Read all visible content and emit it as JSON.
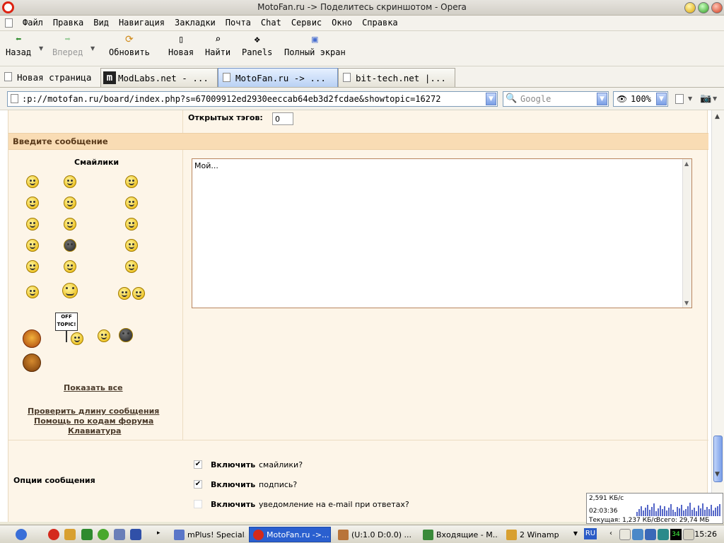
{
  "window": {
    "title": "MotoFan.ru -> Поделитесь скриншотом - Opera"
  },
  "menu": [
    "Файл",
    "Правка",
    "Вид",
    "Навигация",
    "Закладки",
    "Почта",
    "Chat",
    "Сервис",
    "Окно",
    "Справка"
  ],
  "toolbar": {
    "back": "Назад",
    "forward": "Вперед",
    "reload": "Обновить",
    "new": "Новая",
    "find": "Найти",
    "panels": "Panels",
    "fullscreen": "Полный экран"
  },
  "tabs": [
    {
      "label": "Новая страница"
    },
    {
      "label": "ModLabs.net - ..."
    },
    {
      "label": "MotoFan.ru -> ..."
    },
    {
      "label": "bit-tech.net |..."
    }
  ],
  "address": {
    "url": ":p://motofan.ru/board/index.php?s=67009912ed2930eeccab64eb3d2fcdae&showtopic=16272",
    "search_placeholder": "Google",
    "zoom": "100%"
  },
  "form": {
    "open_tags_label": "Открытых тэгов:",
    "open_tags_value": "0",
    "section_title": "Введите сообщение",
    "smilies_title": "Смайлики",
    "offtopic_line1": "OFF",
    "offtopic_line2": "TOPIC!",
    "show_all": "Показать все",
    "check_length": "Проверить длину сообщения",
    "bbcode_help": "Помощь по кодам форума",
    "keyboard": "Клавиатура",
    "message_text": "Мой...",
    "options_title": "Опции сообщения",
    "options": [
      {
        "bold": "Включить",
        "rest": "смайлики?",
        "checked": true
      },
      {
        "bold": "Включить",
        "rest": "подпись?",
        "checked": true
      },
      {
        "bold": "Включить",
        "rest": "уведомление на e-mail при ответах?",
        "checked": false
      }
    ]
  },
  "netmeter": {
    "speed": "2,591 КБ/с",
    "time": "02:03:36",
    "current": "Текущая: 1,237 КБ/с",
    "total": "Всего: 29,74 МБ"
  },
  "taskbar": {
    "tasks": [
      {
        "label": "mPlus! Special..."
      },
      {
        "label": "MotoFan.ru ->..."
      },
      {
        "label": "(U:1.0 D:0.0) ..."
      },
      {
        "label": "Входящие - M..."
      },
      {
        "label": "2 Winamp"
      }
    ],
    "lang": "RU",
    "tray_num": "34",
    "clock": "15:26"
  },
  "colors": {
    "accent": "#2a5fcf",
    "panel": "#fdf5e8",
    "section_header": "#f9dcb4"
  }
}
